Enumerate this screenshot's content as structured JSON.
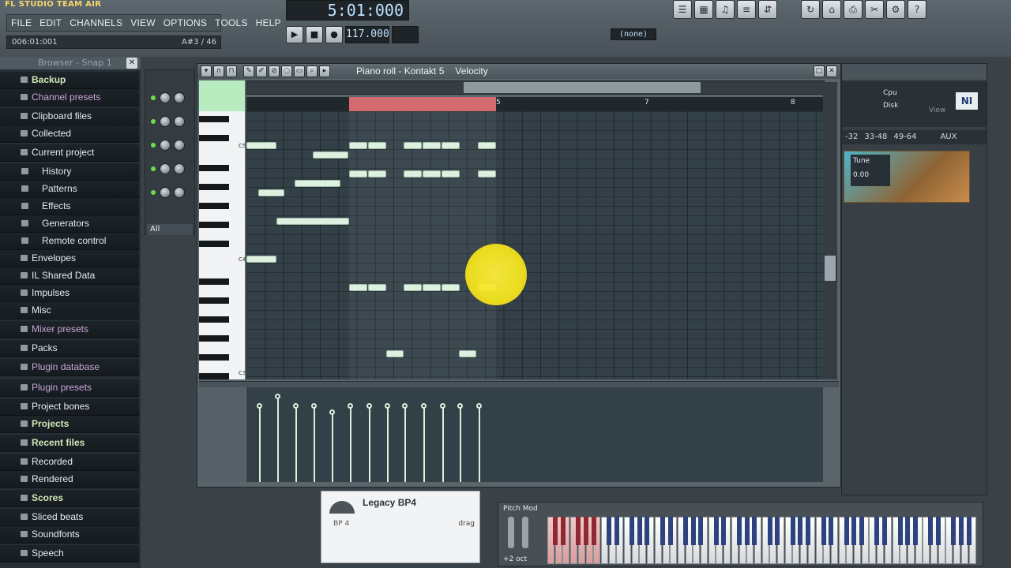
{
  "app": {
    "logo": "FL STUDIO  TEAM AIR"
  },
  "menu": [
    "FILE",
    "EDIT",
    "CHANNELS",
    "VIEW",
    "OPTIONS",
    "TOOLS",
    "HELP"
  ],
  "hint": {
    "left": "006:01:001",
    "right": "A#3 / 46"
  },
  "transport": {
    "song_time": "5:01:000",
    "tempo": "117.000",
    "pattern_none": "(none)"
  },
  "browser": {
    "title": "Browser - Snap 1",
    "items": [
      {
        "label": "Backup",
        "style": "green"
      },
      {
        "label": "Channel presets",
        "style": "special"
      },
      {
        "label": "Clipboard files",
        "style": "dark"
      },
      {
        "label": "Collected",
        "style": "dark"
      },
      {
        "label": "Current project",
        "style": "dark"
      },
      {
        "label": "History",
        "style": "sub"
      },
      {
        "label": "Patterns",
        "style": "sub"
      },
      {
        "label": "Effects",
        "style": "sub"
      },
      {
        "label": "Generators",
        "style": "sub"
      },
      {
        "label": "Remote control",
        "style": "sub"
      },
      {
        "label": "Envelopes",
        "style": "dark"
      },
      {
        "label": "IL Shared Data",
        "style": "dark"
      },
      {
        "label": "Impulses",
        "style": "dark"
      },
      {
        "label": "Misc",
        "style": "dark"
      },
      {
        "label": "Mixer presets",
        "style": "special"
      },
      {
        "label": "Packs",
        "style": "dark"
      },
      {
        "label": "Plugin database",
        "style": "special"
      },
      {
        "label": "Plugin presets",
        "style": "special"
      },
      {
        "label": "Project bones",
        "style": "dark"
      },
      {
        "label": "Projects",
        "style": "green"
      },
      {
        "label": "Recent files",
        "style": "green"
      },
      {
        "label": "Recorded",
        "style": "dark"
      },
      {
        "label": "Rendered",
        "style": "dark"
      },
      {
        "label": "Scores",
        "style": "green"
      },
      {
        "label": "Sliced beats",
        "style": "dark"
      },
      {
        "label": "Soundfonts",
        "style": "dark"
      },
      {
        "label": "Speech",
        "style": "dark"
      }
    ]
  },
  "channel_rack": {
    "filter": "All"
  },
  "piano_roll": {
    "title": "Piano roll - Kontakt 5",
    "target": "Velocity",
    "bars": [
      "5",
      "7",
      "8"
    ],
    "octave_labels": [
      "C5",
      "C4",
      "C3"
    ]
  },
  "kontakt": {
    "ranges": [
      "-32",
      "33-48",
      "49-64",
      "AUX"
    ],
    "cpu": "Cpu",
    "disk": "Disk",
    "view": "View",
    "tune_label": "Tune",
    "tune_value": "0.00"
  },
  "plugin": {
    "name": "Legacy BP4",
    "sub": "BP 4",
    "drag": "drag"
  },
  "keyboard": {
    "label": "Pitch Mod",
    "octave": "+2 oct"
  },
  "colors": {
    "loop": "#d36a6f",
    "note": "#dcf1df",
    "cursor": "#f5e42a"
  }
}
